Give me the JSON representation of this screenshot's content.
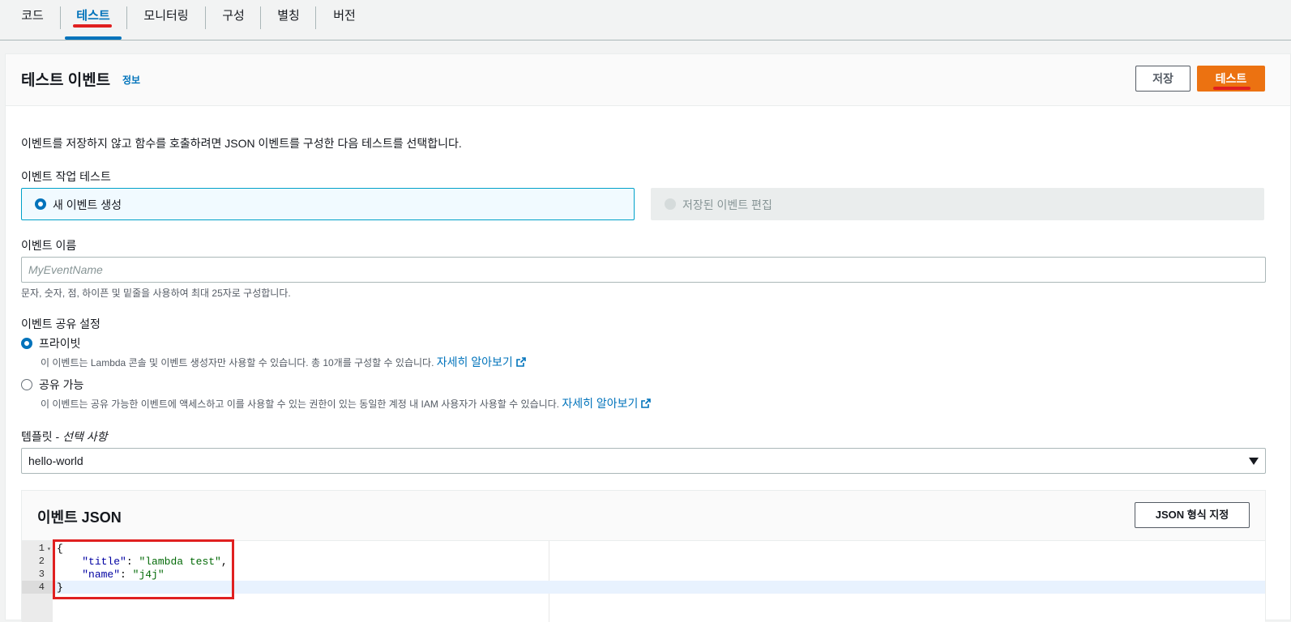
{
  "tabs": [
    {
      "label": "코드"
    },
    {
      "label": "테스트"
    },
    {
      "label": "모니터링"
    },
    {
      "label": "구성"
    },
    {
      "label": "별칭"
    },
    {
      "label": "버전"
    }
  ],
  "card": {
    "title": "테스트 이벤트",
    "info_link": "정보",
    "save_label": "저장",
    "test_label": "테스트"
  },
  "description": "이벤트를 저장하지 않고 함수를 호출하려면 JSON 이벤트를 구성한 다음 테스트를 선택합니다.",
  "event_action": {
    "label": "이벤트 작업 테스트",
    "options": [
      {
        "label": "새 이벤트 생성",
        "selected": true
      },
      {
        "label": "저장된 이벤트 편집",
        "disabled": true
      }
    ]
  },
  "event_name": {
    "label": "이벤트 이름",
    "placeholder": "MyEventName",
    "value": "",
    "hint": "문자, 숫자, 점, 하이픈 및 밑줄을 사용하여 최대 25자로 구성합니다."
  },
  "sharing": {
    "label": "이벤트 공유 설정",
    "options": [
      {
        "label": "프라이빗",
        "selected": true,
        "desc": "이 이벤트는 Lambda 콘솔 및 이벤트 생성자만 사용할 수 있습니다. 총 10개를 구성할 수 있습니다.",
        "link": "자세히 알아보기"
      },
      {
        "label": "공유 가능",
        "selected": false,
        "desc": "이 이벤트는 공유 가능한 이벤트에 액세스하고 이를 사용할 수 있는 권한이 있는 동일한 계정 내 IAM 사용자가 사용할 수 있습니다.",
        "link": "자세히 알아보기"
      }
    ]
  },
  "template": {
    "label": "템플릿 - ",
    "label_optional": "선택 사항",
    "value": "hello-world"
  },
  "event_json": {
    "title": "이벤트 JSON",
    "format_button": "JSON 형식 지정",
    "line_numbers": [
      "1",
      "2",
      "3",
      "4"
    ],
    "lines": [
      "{",
      "    \"title\": \"lambda test\",",
      "    \"name\": \"j4j\"",
      "}"
    ]
  },
  "colors": {
    "accent": "#0073bb",
    "primary_button": "#ec7211",
    "annotation": "#e02020"
  }
}
